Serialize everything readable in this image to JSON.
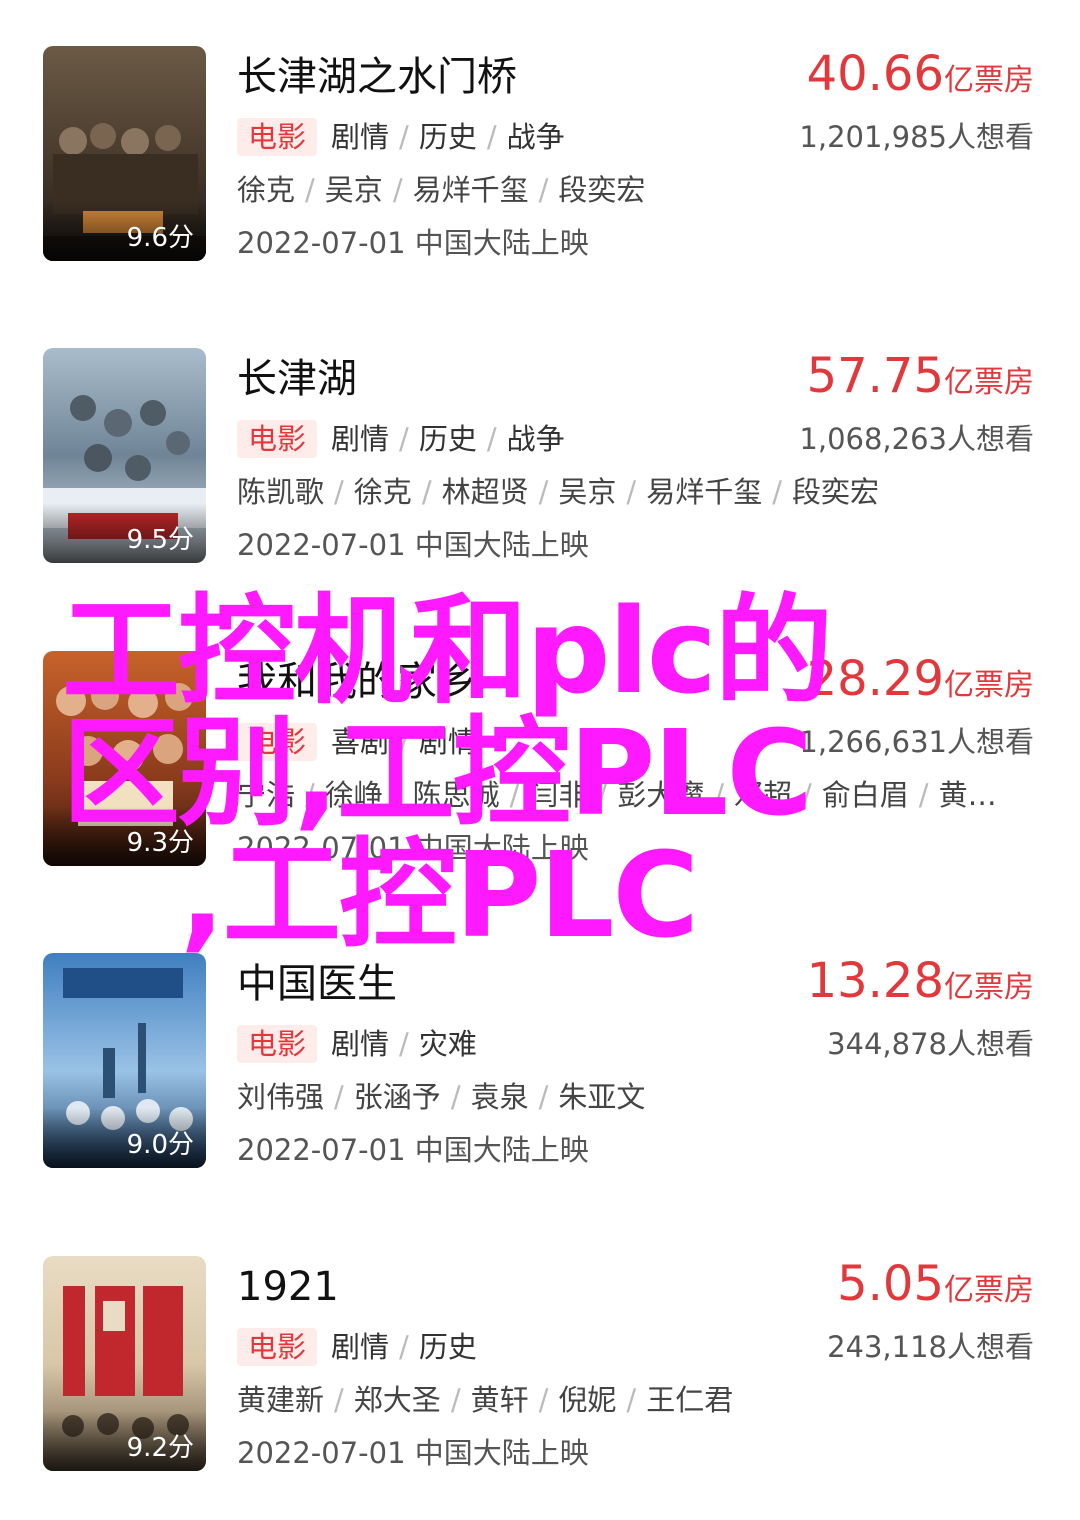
{
  "movies": [
    {
      "title": "长津湖之水门桥",
      "score": "9.6分",
      "box_number": "40.66",
      "box_unit": "亿票房",
      "badge": "电影",
      "genres": [
        "剧情",
        "历史",
        "战争"
      ],
      "want": "1,201,985人想看",
      "cast": [
        "徐克",
        "吴京",
        "易烊千玺",
        "段奕宏"
      ],
      "release": "2022-07-01 中国大陆上映"
    },
    {
      "title": "长津湖",
      "score": "9.5分",
      "box_number": "57.75",
      "box_unit": "亿票房",
      "badge": "电影",
      "genres": [
        "剧情",
        "历史",
        "战争"
      ],
      "want": "1,068,263人想看",
      "cast": [
        "陈凯歌",
        "徐克",
        "林超贤",
        "吴京",
        "易烊千玺",
        "段奕宏"
      ],
      "release": "2022-07-01 中国大陆上映"
    },
    {
      "title": "我和我的家乡",
      "score": "9.3分",
      "box_number": "28.29",
      "box_unit": "亿票房",
      "badge": "电影",
      "genres": [
        "喜剧",
        "剧情"
      ],
      "want": "1,266,631人想看",
      "cast": [
        "宁浩",
        "徐峥",
        "陈思诚",
        "闫非",
        "彭大魔",
        "邓超",
        "俞白眉",
        "黄…"
      ],
      "release": "2022-07-01 中国大陆上映"
    },
    {
      "title": "中国医生",
      "score": "9.0分",
      "box_number": "13.28",
      "box_unit": "亿票房",
      "badge": "电影",
      "genres": [
        "剧情",
        "灾难"
      ],
      "want": "344,878人想看",
      "cast": [
        "刘伟强",
        "张涵予",
        "袁泉",
        "朱亚文"
      ],
      "release": "2022-07-01 中国大陆上映"
    },
    {
      "title": "1921",
      "score": "9.2分",
      "box_number": "5.05",
      "box_unit": "亿票房",
      "badge": "电影",
      "genres": [
        "剧情",
        "历史"
      ],
      "want": "243,118人想看",
      "cast": [
        "黄建新",
        "郑大圣",
        "黄轩",
        "倪妮",
        "王仁君"
      ],
      "release": "2022-07-01 中国大陆上映"
    }
  ],
  "overlay_lines": [
    "工控机和plc的",
    "区别,工控PLC",
    ",工控PLC"
  ],
  "colors": {
    "box_office": "#e2383c",
    "overlay": "#ff19ff",
    "badge_bg": "#fdecea"
  }
}
